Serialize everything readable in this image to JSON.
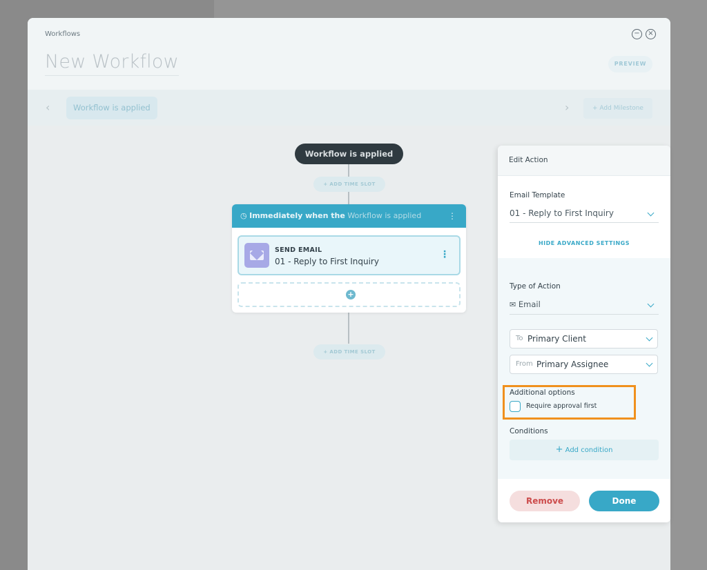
{
  "header": {
    "breadcrumb": "Workflows",
    "title": "New Workflow",
    "minimize_icon": "minus-circle-icon",
    "close_icon": "close-circle-icon",
    "preview_label": "PREVIEW"
  },
  "milestones": {
    "prev_icon": "chevron-left-icon",
    "next_icon": "chevron-right-icon",
    "current": "Workflow is applied",
    "add_label": "+ Add Milestone"
  },
  "canvas": {
    "start_node": "Workflow is applied",
    "time_slot_label": "+ ADD TIME SLOT",
    "step": {
      "header_bold": "Immediately when the",
      "header_rest": "Workflow is applied",
      "action_type": "SEND EMAIL",
      "action_name": "01 - Reply to First Inquiry"
    }
  },
  "panel": {
    "title": "Edit Action",
    "email_template_label": "Email Template",
    "email_template_value": "01 - Reply to First Inquiry",
    "hide_advanced": "HIDE ADVANCED SETTINGS",
    "type_label": "Type of Action",
    "type_value": "Email",
    "to_prefix": "To",
    "to_value": "Primary Client",
    "from_prefix": "From",
    "from_value": "Primary Assignee",
    "additional_options_label": "Additional options",
    "require_approval_label": "Require approval first",
    "require_approval_checked": false,
    "conditions_label": "Conditions",
    "add_condition_label": "Add condition",
    "remove_label": "Remove",
    "done_label": "Done"
  },
  "colors": {
    "accent": "#38a8c7",
    "remove": "#cc4c4c",
    "highlight": "#f0901d"
  }
}
